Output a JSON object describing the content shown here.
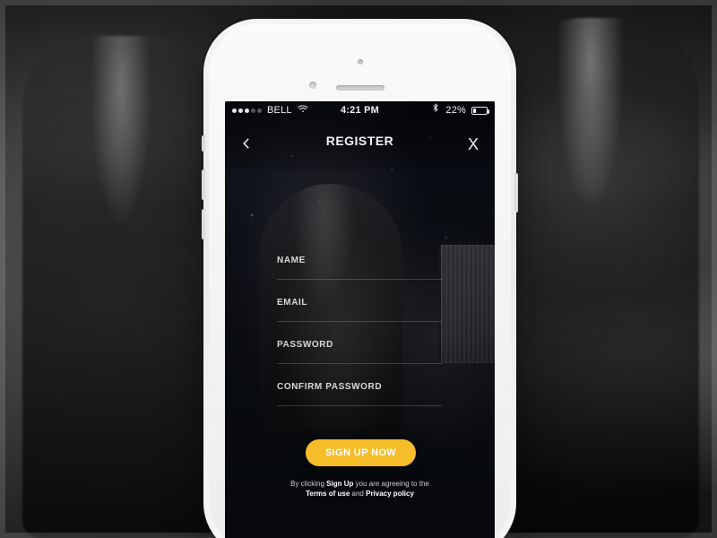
{
  "status_bar": {
    "carrier": "BELL",
    "time": "4:21 PM",
    "battery_percent": "22%"
  },
  "header": {
    "title": "REGISTER",
    "back_icon": "chevron-left-icon",
    "close_icon": "close-icon",
    "close_text": "X",
    "back_text": "<"
  },
  "form": {
    "fields": [
      {
        "label": "NAME"
      },
      {
        "label": "EMAIL"
      },
      {
        "label": "PASSWORD"
      },
      {
        "label": "CONFIRM PASSWORD"
      }
    ]
  },
  "cta": {
    "label": "SIGN UP NOW",
    "color": "#f6bd2a"
  },
  "legal": {
    "line1_prefix": "By clicking",
    "line1_bold": "Sign Up",
    "line1_suffix": "you are agreeing to the",
    "terms": "Terms of use",
    "and": "and",
    "privacy": "Privacy policy"
  }
}
